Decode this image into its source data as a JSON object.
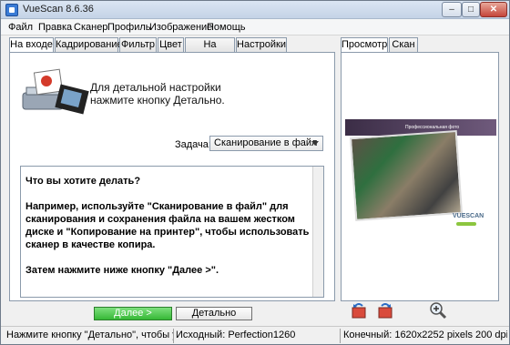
{
  "window": {
    "title": "VueScan 8.6.36"
  },
  "menubar": [
    "Файл",
    "Правка",
    "Сканер",
    "Профиль",
    "Изображение",
    "Помощь"
  ],
  "left_tabs": [
    "На входе",
    "Кадрирование",
    "Фильтр",
    "Цвет",
    "На выходе",
    "Настройки"
  ],
  "right_tabs": [
    "Просмотр",
    "Скан"
  ],
  "info": {
    "line1": "Для детальной настройки",
    "line2": "нажмите кнопку Детально."
  },
  "task": {
    "label": "Задача:",
    "value": "Сканирование в файл"
  },
  "help_text": [
    "Что вы хотите делать?",
    "Например, используйте \"Сканирование в файл\" для сканирования и сохранения файла на вашем жестком диске и \"Копирование на принтер\", чтобы использовать сканер в качестве копира.",
    "Затем нажмите ниже кнопку \"Далее >\"."
  ],
  "buttons": {
    "next": "Далее >",
    "detail": "Детально"
  },
  "preview": {
    "band_text": "Профессиональная фото",
    "logo_text": "VUESCAN"
  },
  "status": {
    "hint": "Нажмите кнопку \"Детально\", чтобы увидет",
    "source": "Исходный: Perfection1260",
    "output": "Конечный: 1620x2252 pixels 200 dpi 206"
  },
  "icons": [
    "minimize-icon",
    "maximize-icon",
    "close-icon",
    "scanner-photo-icon",
    "rotate-left-icon",
    "rotate-right-icon",
    "zoom-icon",
    "dropdown-arrow-icon"
  ]
}
